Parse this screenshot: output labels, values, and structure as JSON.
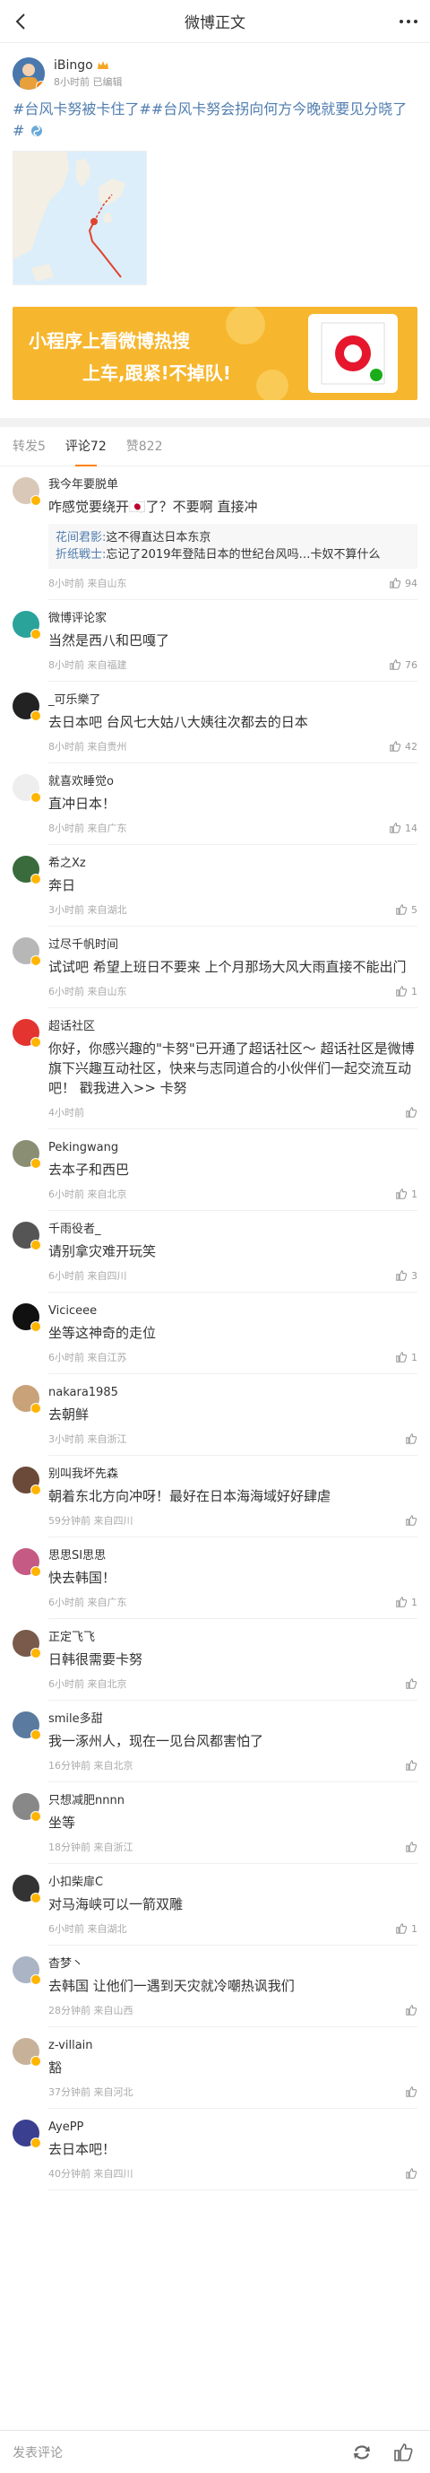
{
  "nav": {
    "title": "微博正文"
  },
  "post": {
    "author": "iBingo",
    "time": "8小时前 已编辑",
    "tag1": "#台风卡努被卡住了#",
    "tag2": "#台风卡努会拐向何方今晚就要见分晓了#",
    "banner_line1": "小程序上看微博热搜",
    "banner_line2": "上车,跟紧!不掉队!"
  },
  "tabs": {
    "repost": "转发5",
    "comment": "评论72",
    "like": "赞822"
  },
  "comments": [
    {
      "name": "我今年要脱单",
      "text": "咋感觉要绕开🇯🇵了？不要啊 直接冲",
      "meta": "8小时前 来自山东",
      "likes": "94",
      "color": "#d9c8b8",
      "replies": [
        {
          "n": "花间君影:",
          "t": "这不得直达日本东京"
        },
        {
          "n": "折纸戦士:",
          "t": "忘记了2019年登陆日本的世纪台风吗…卡奴不算什么"
        }
      ]
    },
    {
      "name": "微博评论家",
      "text": "当然是西八和巴嘎了",
      "meta": "8小时前 来自福建",
      "likes": "76",
      "color": "#2aa39a"
    },
    {
      "name": "_可乐樂了",
      "text": "去日本吧 台风七大姑八大姨往次都去的日本",
      "meta": "8小时前 来自贵州",
      "likes": "42",
      "color": "#222"
    },
    {
      "name": "就喜欢睡觉o",
      "text": "直冲日本！",
      "meta": "8小时前 来自广东",
      "likes": "14",
      "color": "#eee"
    },
    {
      "name": "希之Xz",
      "text": "奔日",
      "meta": "3小时前 来自湖北",
      "likes": "5",
      "color": "#3a6b3c"
    },
    {
      "name": "过尽千帆时间",
      "text": "试试吧 希望上班日不要来 上个月那场大风大雨直接不能出门",
      "meta": "6小时前 来自山东",
      "likes": "1",
      "color": "#b7b7b7"
    },
    {
      "name": "超话社区",
      "text": "你好，你感兴趣的\"卡努\"已开通了超话社区～ 超话社区是微博旗下兴趣互动社区，快来与志同道合的小伙伴们一起交流互动吧！ 戳我进入>> 卡努",
      "meta": "4小时前",
      "likes": "",
      "color": "#e3342f"
    },
    {
      "name": "Pekingwang",
      "text": "去本子和西巴",
      "meta": "6小时前 来自北京",
      "likes": "1",
      "color": "#8a8f74"
    },
    {
      "name": "千雨役者_",
      "text": "请别拿灾难开玩笑",
      "meta": "6小时前 来自四川",
      "likes": "3",
      "color": "#555"
    },
    {
      "name": "Viciceee",
      "text": "坐等这神奇的走位",
      "meta": "6小时前 来自江苏",
      "likes": "1",
      "color": "#111"
    },
    {
      "name": "nakara1985",
      "text": "去朝鲜",
      "meta": "3小时前 来自浙江",
      "likes": "",
      "color": "#c9a27a"
    },
    {
      "name": "别叫我坏先森",
      "text": "朝着东北方向冲呀！最好在日本海海域好好肆虐",
      "meta": "59分钟前 来自四川",
      "likes": "",
      "color": "#6b4a3a"
    },
    {
      "name": "思思SI思思",
      "text": "快去韩国！",
      "meta": "6小时前 来自广东",
      "likes": "1",
      "color": "#c55a84"
    },
    {
      "name": "正定飞飞",
      "text": "日韩很需要卡努",
      "meta": "6小时前 来自北京",
      "likes": "",
      "color": "#7a5a4a"
    },
    {
      "name": "smile多甜",
      "text": "我一涿州人，现在一见台风都害怕了",
      "meta": "16分钟前 来自北京",
      "likes": "",
      "color": "#5a7aa0"
    },
    {
      "name": "只想减肥nnnn",
      "text": "坐等",
      "meta": "18分钟前 来自浙江",
      "likes": "",
      "color": "#888"
    },
    {
      "name": "小扣柴扉C",
      "text": "对马海峡可以一箭双雕",
      "meta": "6小时前 来自湖北",
      "likes": "1",
      "color": "#333"
    },
    {
      "name": "杳梦丶",
      "text": "去韩国 让他们一遇到天灾就冷嘲热讽我们",
      "meta": "28分钟前 来自山西",
      "likes": "",
      "color": "#aab4c4"
    },
    {
      "name": "z-villain",
      "text": "豁",
      "meta": "37分钟前 来自河北",
      "likes": "",
      "color": "#c7b299"
    },
    {
      "name": "AyePP",
      "text": "去日本吧！",
      "meta": "40分钟前 来自四川",
      "likes": "",
      "color": "#3b3f8f"
    }
  ],
  "bottom": {
    "placeholder": "发表评论"
  }
}
